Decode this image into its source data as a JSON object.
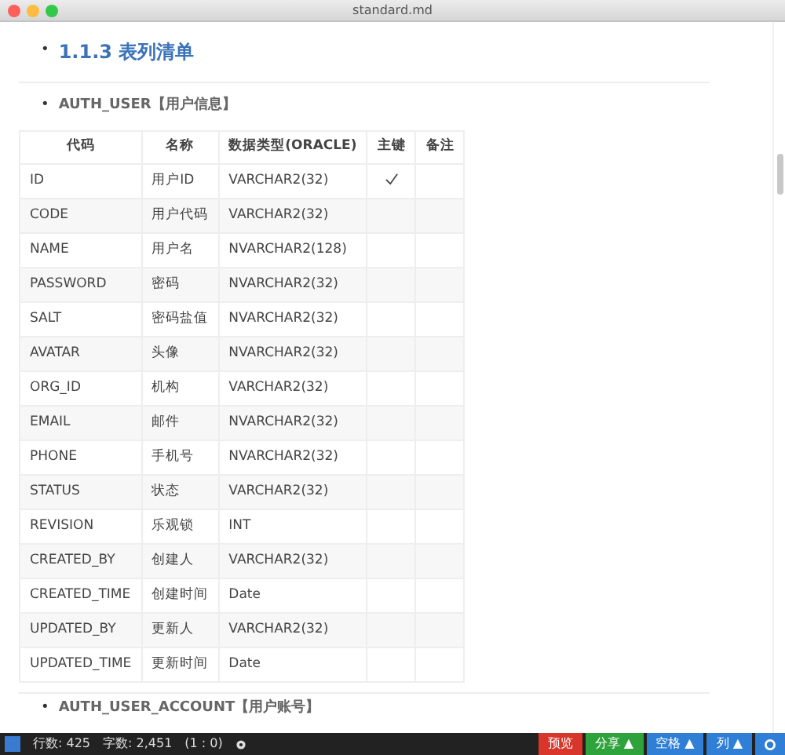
{
  "window": {
    "title": "standard.md"
  },
  "heading": {
    "bullet": "•",
    "text": "1.1.3 表列清单"
  },
  "table_title": {
    "bullet": "•",
    "text": "AUTH_USER【用户信息】"
  },
  "table": {
    "columns": [
      "代码",
      "名称",
      "数据类型(ORACLE)",
      "主键",
      "备注"
    ],
    "rows": [
      {
        "code": "ID",
        "name": "用户ID",
        "type": "VARCHAR2(32)",
        "primary_key": true
      },
      {
        "code": "CODE",
        "name": "用户代码",
        "type": "VARCHAR2(32)",
        "primary_key": false
      },
      {
        "code": "NAME",
        "name": "用户名",
        "type": "NVARCHAR2(128)",
        "primary_key": false
      },
      {
        "code": "PASSWORD",
        "name": "密码",
        "type": "NVARCHAR2(32)",
        "primary_key": false
      },
      {
        "code": "SALT",
        "name": "密码盐值",
        "type": "NVARCHAR2(32)",
        "primary_key": false
      },
      {
        "code": "AVATAR",
        "name": "头像",
        "type": "NVARCHAR2(32)",
        "primary_key": false
      },
      {
        "code": "ORG_ID",
        "name": "机构",
        "type": "VARCHAR2(32)",
        "primary_key": false
      },
      {
        "code": "EMAIL",
        "name": "邮件",
        "type": "NVARCHAR2(32)",
        "primary_key": false
      },
      {
        "code": "PHONE",
        "name": "手机号",
        "type": "NVARCHAR2(32)",
        "primary_key": false
      },
      {
        "code": "STATUS",
        "name": "状态",
        "type": "VARCHAR2(32)",
        "primary_key": false
      },
      {
        "code": "REVISION",
        "name": "乐观锁",
        "type": "INT",
        "primary_key": false
      },
      {
        "code": "CREATED_BY",
        "name": "创建人",
        "type": "VARCHAR2(32)",
        "primary_key": false
      },
      {
        "code": "CREATED_TIME",
        "name": "创建时间",
        "type": "Date",
        "primary_key": false
      },
      {
        "code": "UPDATED_BY",
        "name": "更新人",
        "type": "VARCHAR2(32)",
        "primary_key": false
      },
      {
        "code": "UPDATED_TIME",
        "name": "更新时间",
        "type": "Date",
        "primary_key": false
      }
    ]
  },
  "next_table_title": {
    "bullet": "•",
    "text": "AUTH_USER_ACCOUNT【用户账号】"
  },
  "status_bar": {
    "lines": "行数: 425",
    "words": "字数: 2,451",
    "cursor": "(1 : 0)",
    "buttons": [
      {
        "label": "预览",
        "color": "#d9362b"
      },
      {
        "label": "分享 ▲",
        "color": "#2fa33b"
      },
      {
        "label": "空格 ▲",
        "color": "#2f7fd6"
      },
      {
        "label": "列 ▲",
        "color": "#2f7fd6"
      }
    ]
  }
}
